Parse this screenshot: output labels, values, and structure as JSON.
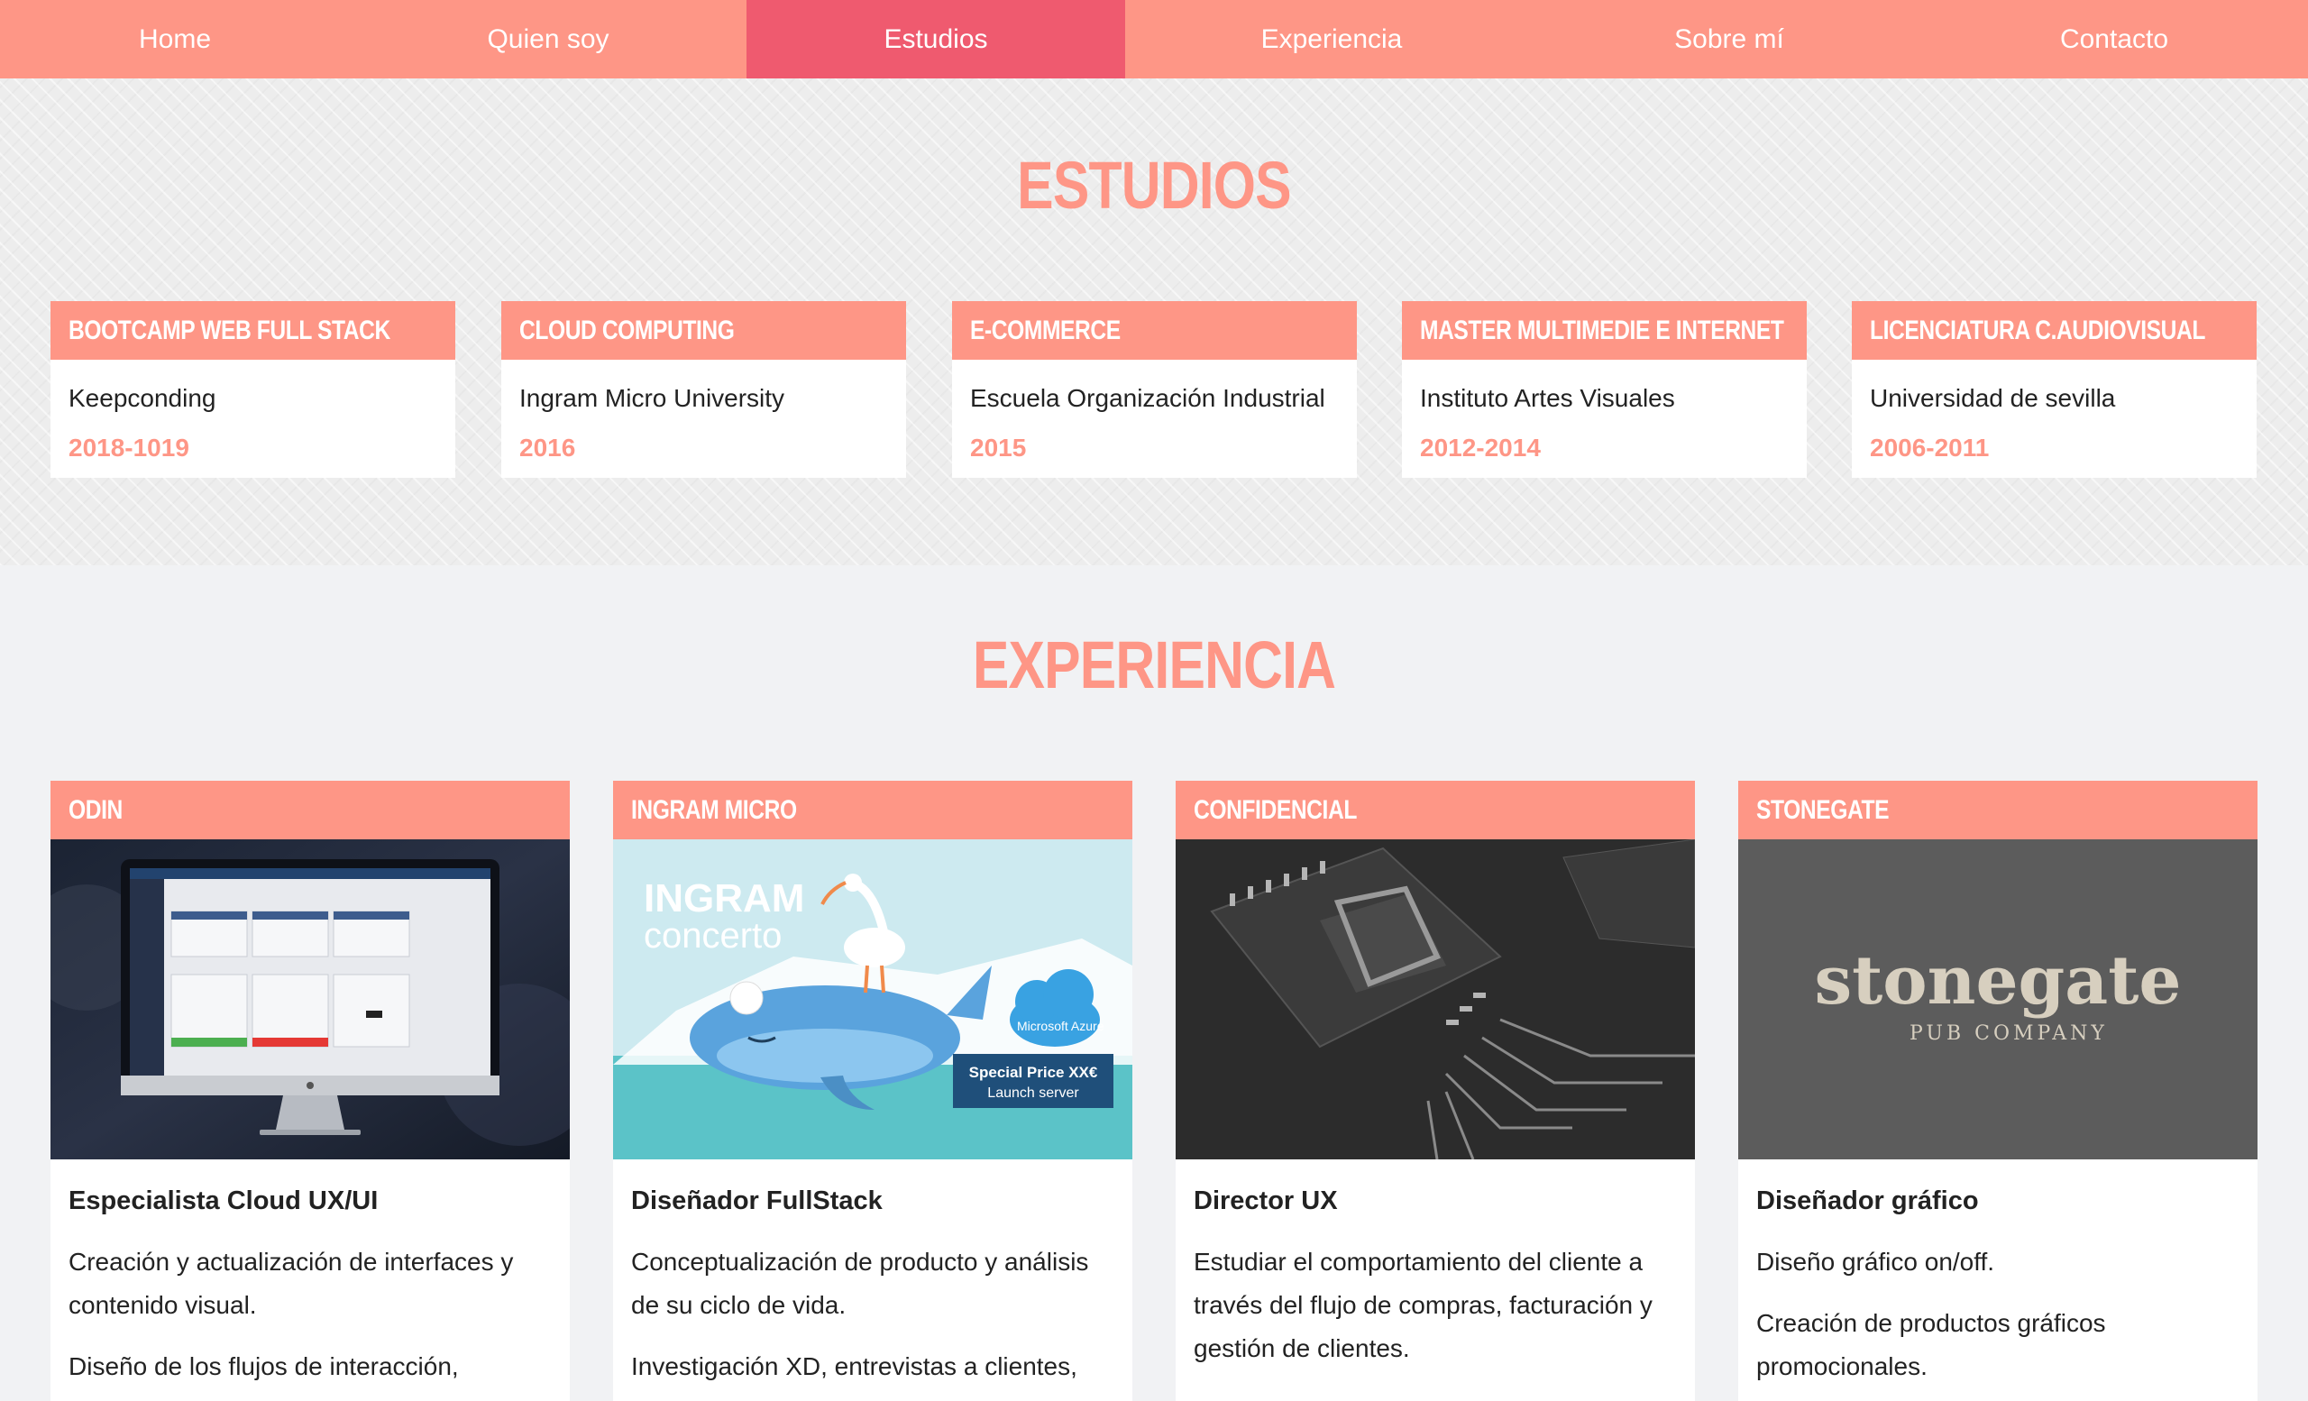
{
  "nav": {
    "items": [
      {
        "label": "Home"
      },
      {
        "label": "Quien soy"
      },
      {
        "label": "Estudios"
      },
      {
        "label": "Experiencia"
      },
      {
        "label": "Sobre mí"
      },
      {
        "label": "Contacto"
      }
    ],
    "active": "Estudios"
  },
  "estudios": {
    "title": "ESTUDIOS",
    "cards": [
      {
        "heading": "BOOTCAMP WEB FULL STACK",
        "institution": "Keepconding",
        "years": "2018-1019"
      },
      {
        "heading": "CLOUD COMPUTING",
        "institution": "Ingram Micro University",
        "years": "2016"
      },
      {
        "heading": "E-COMMERCE",
        "institution": "Escuela Organización Industrial",
        "years": "2015"
      },
      {
        "heading": "MASTER MULTIMEDIE E INTERNET",
        "institution": "Instituto Artes Visuales",
        "years": "2012-2014"
      },
      {
        "heading": "LICENCIATURA C.AUDIOVISUAL",
        "institution": "Universidad de sevilla",
        "years": "2006-2011"
      }
    ]
  },
  "experiencia": {
    "title": "EXPERIENCIA",
    "cards": [
      {
        "heading": "ODIN",
        "role": "Especialista Cloud UX/UI",
        "paragraphs": [
          "Creación y actualización de interfaces y contenido visual.",
          "Diseño de los flujos de interacción,"
        ]
      },
      {
        "heading": "INGRAM MICRO",
        "role": "Diseñador FullStack",
        "paragraphs": [
          "Conceptualización de producto y análisis de su ciclo de vida.",
          "Investigación XD, entrevistas a clientes,"
        ],
        "image_text": {
          "brand": "INGRAM",
          "product": "concerto",
          "cloud": "Microsoft Azure",
          "price": "Special Price XX€",
          "price_sub": "Launch server"
        }
      },
      {
        "heading": "CONFIDENCIAL",
        "role": "Director UX",
        "paragraphs": [
          "Estudiar el comportamiento del cliente a través del flujo de compras, facturación y gestión de clientes."
        ]
      },
      {
        "heading": "STONEGATE",
        "role": "Diseñador gráfico",
        "paragraphs": [
          "Diseño gráfico on/off.",
          "Creación de productos gráficos promocionales."
        ]
      }
    ]
  },
  "colors": {
    "accent": "#fe9686",
    "active_nav": "#ef5a6f",
    "background": "#f1f2f4"
  }
}
